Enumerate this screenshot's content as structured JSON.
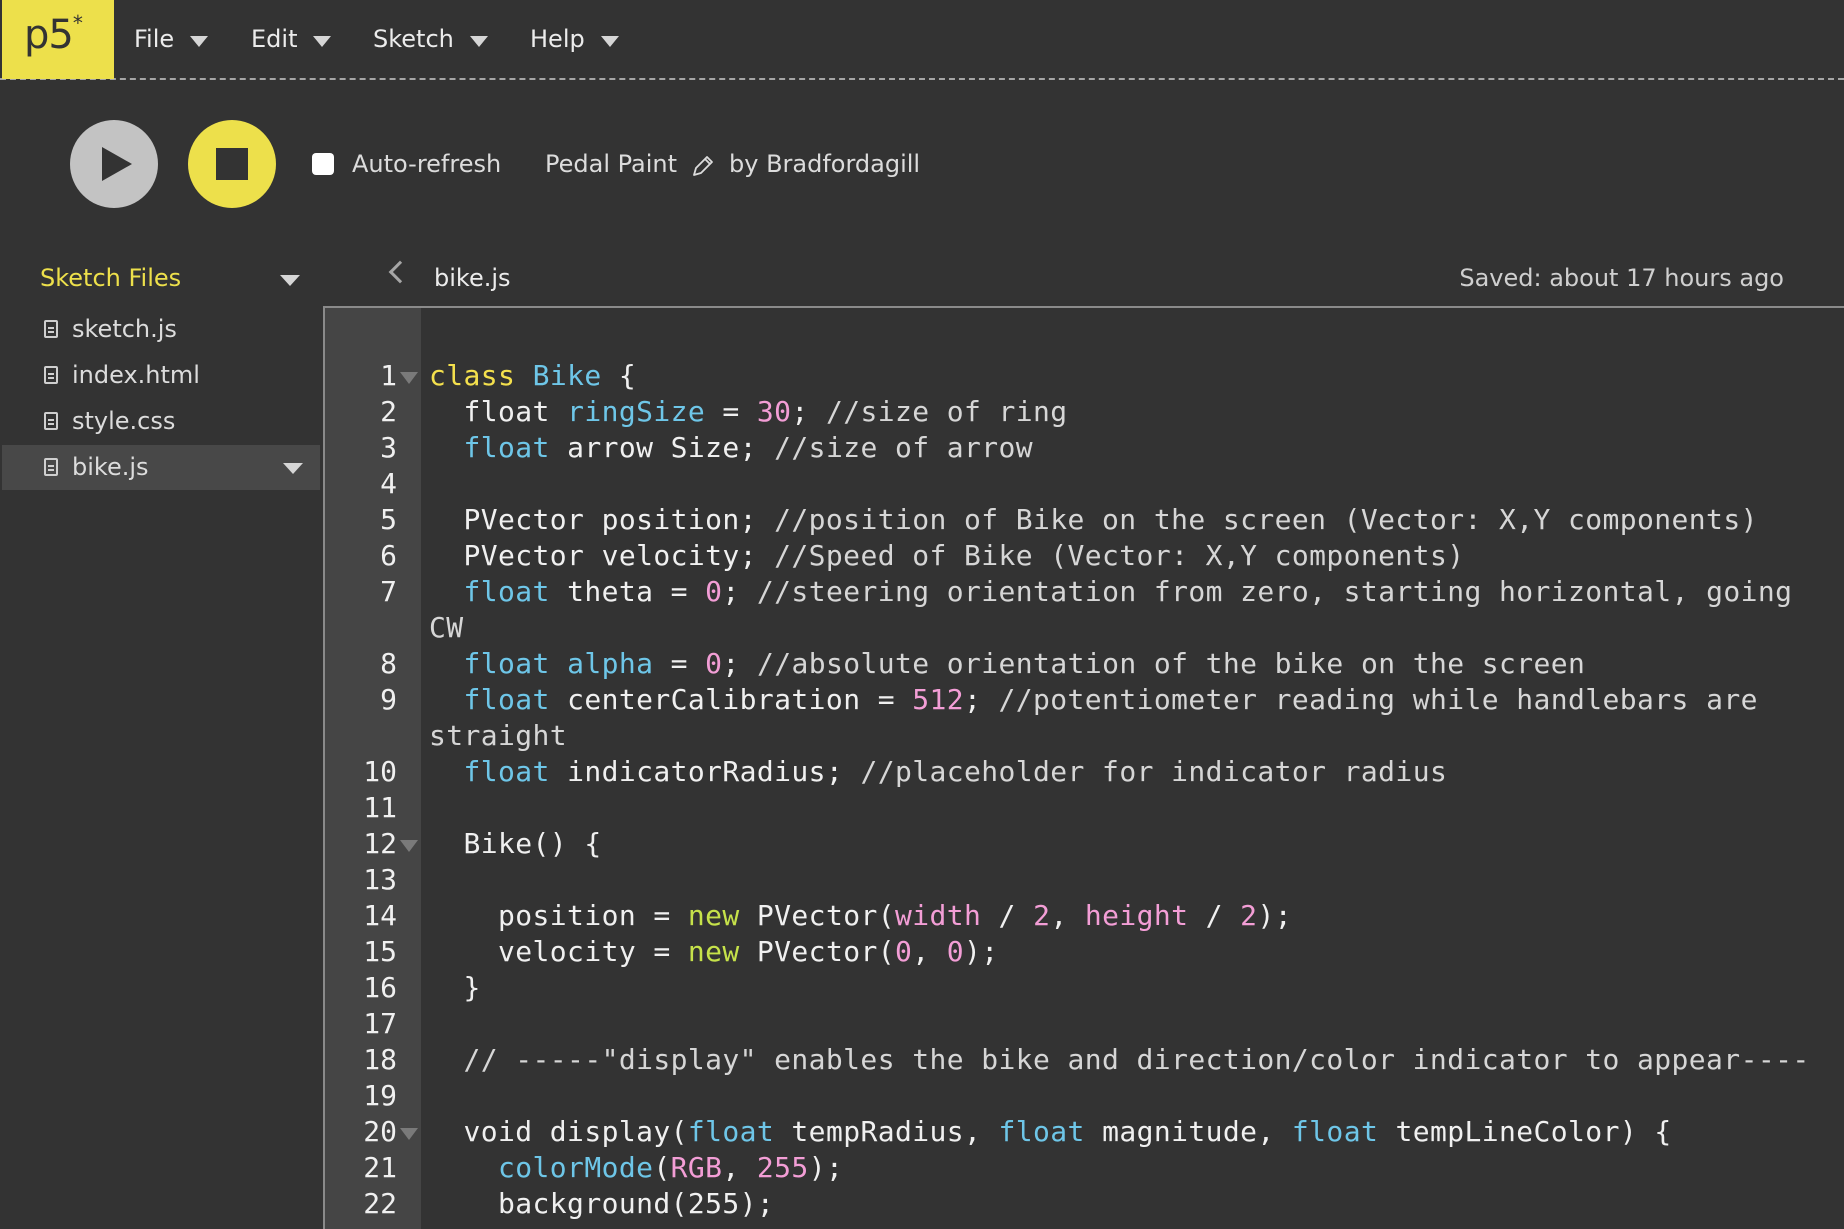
{
  "app": {
    "logo_text": "p5",
    "logo_mark": "*"
  },
  "menu": [
    {
      "label": "File"
    },
    {
      "label": "Edit"
    },
    {
      "label": "Sketch"
    },
    {
      "label": "Help"
    }
  ],
  "toolbar": {
    "autorefresh_label": "Auto-refresh",
    "autorefresh_checked": false,
    "sketch_name": "Pedal Paint",
    "owner": "by Bradfordagill"
  },
  "sidebar": {
    "title": "Sketch Files",
    "files": [
      {
        "name": "sketch.js",
        "selected": false
      },
      {
        "name": "index.html",
        "selected": false
      },
      {
        "name": "style.css",
        "selected": false
      },
      {
        "name": "bike.js",
        "selected": true
      }
    ]
  },
  "editor": {
    "filename": "bike.js",
    "saved_status": "Saved: about 17 hours ago",
    "lines": [
      {
        "n": "1",
        "fold": true,
        "tokens": [
          [
            "kw-yellow",
            "class"
          ],
          [
            "",
            " "
          ],
          [
            "kw-blue",
            "Bike"
          ],
          [
            "",
            " {"
          ]
        ]
      },
      {
        "n": "2",
        "tokens": [
          [
            "",
            "  float "
          ],
          [
            "kw-blue",
            "ringSize"
          ],
          [
            "",
            " = "
          ],
          [
            "num-pink",
            "30"
          ],
          [
            "",
            "; "
          ],
          [
            "cm",
            "//size of ring"
          ]
        ]
      },
      {
        "n": "3",
        "tokens": [
          [
            "",
            "  "
          ],
          [
            "kw-blue",
            "float"
          ],
          [
            "",
            " arrow Size; "
          ],
          [
            "cm",
            "//size of arrow"
          ]
        ]
      },
      {
        "n": "4",
        "tokens": [
          [
            "",
            ""
          ]
        ]
      },
      {
        "n": "5",
        "tokens": [
          [
            "",
            "  PVector position; "
          ],
          [
            "cm",
            "//position of Bike on the screen (Vector: X,Y components)"
          ]
        ]
      },
      {
        "n": "6",
        "tokens": [
          [
            "",
            "  PVector velocity; "
          ],
          [
            "cm",
            "//Speed of Bike (Vector: X,Y components)"
          ]
        ]
      },
      {
        "n": "7",
        "tokens": [
          [
            "",
            "  "
          ],
          [
            "kw-blue",
            "float"
          ],
          [
            "",
            " theta = "
          ],
          [
            "num-pink",
            "0"
          ],
          [
            "",
            "; "
          ],
          [
            "cm",
            "//steering orientation from zero, starting horizontal, going CW"
          ]
        ]
      },
      {
        "n": "8",
        "tokens": [
          [
            "",
            "  "
          ],
          [
            "kw-blue",
            "float"
          ],
          [
            "",
            " "
          ],
          [
            "kw-blue",
            "alpha"
          ],
          [
            "",
            " = "
          ],
          [
            "num-pink",
            "0"
          ],
          [
            "",
            "; "
          ],
          [
            "cm",
            "//absolute orientation of the bike on the screen"
          ]
        ]
      },
      {
        "n": "9",
        "tokens": [
          [
            "",
            "  "
          ],
          [
            "kw-blue",
            "float"
          ],
          [
            "",
            " centerCalibration = "
          ],
          [
            "num-pink",
            "512"
          ],
          [
            "",
            "; "
          ],
          [
            "cm",
            "//potentiometer reading while handlebars are straight"
          ]
        ]
      },
      {
        "n": "10",
        "tokens": [
          [
            "",
            "  "
          ],
          [
            "kw-blue",
            "float"
          ],
          [
            "",
            " indicatorRadius; "
          ],
          [
            "cm",
            "//placeholder for indicator radius"
          ]
        ]
      },
      {
        "n": "11",
        "tokens": [
          [
            "",
            ""
          ]
        ]
      },
      {
        "n": "12",
        "fold": true,
        "tokens": [
          [
            "",
            "  Bike() {"
          ]
        ]
      },
      {
        "n": "13",
        "tokens": [
          [
            "",
            ""
          ]
        ]
      },
      {
        "n": "14",
        "tokens": [
          [
            "",
            "    position = "
          ],
          [
            "kw-green",
            "new"
          ],
          [
            "",
            " PVector("
          ],
          [
            "num-pink",
            "width"
          ],
          [
            "",
            " / "
          ],
          [
            "num-pink",
            "2"
          ],
          [
            "",
            ", "
          ],
          [
            "num-pink",
            "height"
          ],
          [
            "",
            " / "
          ],
          [
            "num-pink",
            "2"
          ],
          [
            "",
            ");"
          ]
        ]
      },
      {
        "n": "15",
        "tokens": [
          [
            "",
            "    velocity = "
          ],
          [
            "kw-green",
            "new"
          ],
          [
            "",
            " PVector("
          ],
          [
            "num-pink",
            "0"
          ],
          [
            "",
            ", "
          ],
          [
            "num-pink",
            "0"
          ],
          [
            "",
            ");"
          ]
        ]
      },
      {
        "n": "16",
        "tokens": [
          [
            "",
            "  }"
          ]
        ]
      },
      {
        "n": "17",
        "tokens": [
          [
            "",
            ""
          ]
        ]
      },
      {
        "n": "18",
        "tokens": [
          [
            "",
            "  "
          ],
          [
            "cm",
            "// -----\"display\" enables the bike and direction/color indicator to appear----"
          ]
        ]
      },
      {
        "n": "19",
        "tokens": [
          [
            "",
            ""
          ]
        ]
      },
      {
        "n": "20",
        "fold": true,
        "tokens": [
          [
            "",
            "  void display("
          ],
          [
            "kw-blue",
            "float"
          ],
          [
            "",
            " tempRadius, "
          ],
          [
            "kw-blue",
            "float"
          ],
          [
            "",
            " magnitude, "
          ],
          [
            "kw-blue",
            "float"
          ],
          [
            "",
            " tempLineColor) {"
          ]
        ]
      },
      {
        "n": "21",
        "tokens": [
          [
            "",
            "    "
          ],
          [
            "kw-blue",
            "colorMode"
          ],
          [
            "",
            "("
          ],
          [
            "num-pink",
            "RGB"
          ],
          [
            "",
            ", "
          ],
          [
            "num-pink",
            "255"
          ],
          [
            "",
            ");"
          ]
        ]
      },
      {
        "n": "22",
        "tokens": [
          [
            "",
            "    background(255);"
          ]
        ]
      }
    ]
  }
}
